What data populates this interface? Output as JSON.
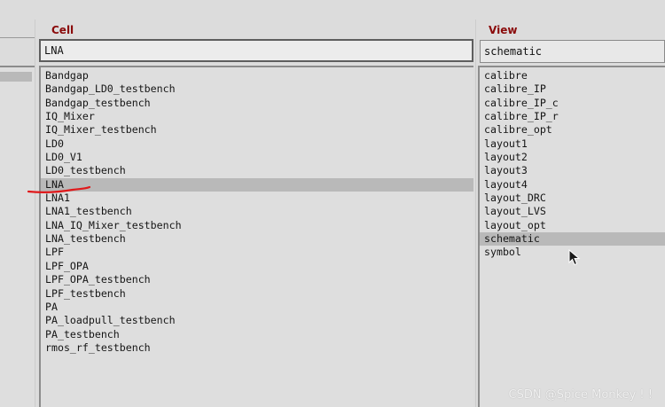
{
  "cell_pane": {
    "title": "Cell",
    "filter_value": "LNA",
    "selected_index": 8,
    "items": [
      "Bandgap",
      "Bandgap_LD0_testbench",
      "Bandgap_testbench",
      "IQ_Mixer",
      "IQ_Mixer_testbench",
      "LD0",
      "LD0_V1",
      "LD0_testbench",
      "LNA",
      "LNA1",
      "LNA1_testbench",
      "LNA_IQ_Mixer_testbench",
      "LNA_testbench",
      "LPF",
      "LPF_OPA",
      "LPF_OPA_testbench",
      "LPF_testbench",
      "PA",
      "PA_loadpull_testbench",
      "PA_testbench",
      "rmos_rf_testbench"
    ]
  },
  "view_pane": {
    "title": "View",
    "filter_value": "schematic",
    "selected_index": 12,
    "items": [
      "calibre",
      "calibre_IP",
      "calibre_IP_c",
      "calibre_IP_r",
      "calibre_opt",
      "layout1",
      "layout2",
      "layout3",
      "layout4",
      "layout_DRC",
      "layout_LVS",
      "layout_opt",
      "schematic",
      "symbol"
    ]
  },
  "annotation_color": "#e0191b",
  "watermark": "CSDN @Spice Monkey ! !"
}
